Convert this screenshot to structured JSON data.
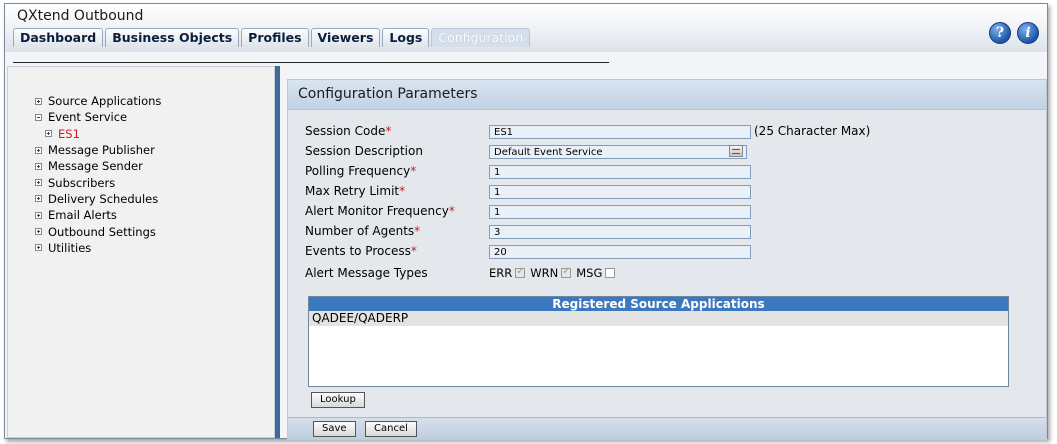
{
  "app": {
    "title": "QXtend Outbound"
  },
  "tabs": [
    {
      "label": "Dashboard"
    },
    {
      "label": "Business Objects"
    },
    {
      "label": "Profiles"
    },
    {
      "label": "Viewers"
    },
    {
      "label": "Logs"
    },
    {
      "label": "Configuration",
      "active": true
    }
  ],
  "header_icons": {
    "help": "help-icon",
    "info": "info-icon",
    "help_glyph": "?",
    "info_glyph": "i"
  },
  "tree": {
    "items": [
      {
        "label": "Source Applications",
        "expander": "plus"
      },
      {
        "label": "Event Service",
        "expander": "minus"
      },
      {
        "label": "ES1",
        "expander": "plus",
        "child": true,
        "selected": true
      },
      {
        "label": "Message Publisher",
        "expander": "plus"
      },
      {
        "label": "Message Sender",
        "expander": "plus"
      },
      {
        "label": "Subscribers",
        "expander": "plus"
      },
      {
        "label": "Delivery Schedules",
        "expander": "plus"
      },
      {
        "label": "Email Alerts",
        "expander": "plus"
      },
      {
        "label": "Outbound Settings",
        "expander": "plus"
      },
      {
        "label": "Utilities",
        "expander": "plus"
      }
    ]
  },
  "config": {
    "title": "Configuration Parameters",
    "fields": {
      "session_code": {
        "label": "Session Code",
        "value": "ES1"
      },
      "session_description": {
        "label": "Session Description",
        "value": "Default Event Service"
      },
      "polling_frequency": {
        "label": "Polling Frequency",
        "value": "1"
      },
      "max_retry_limit": {
        "label": "Max Retry Limit",
        "value": "1"
      },
      "alert_monitor_frequency": {
        "label": "Alert Monitor Frequency",
        "value": "1"
      },
      "number_of_agents": {
        "label": "Number of Agents",
        "value": "3"
      },
      "events_to_process": {
        "label": "Events to Process",
        "value": "20"
      },
      "alert_message_types": {
        "label": "Alert Message Types"
      }
    },
    "required_marker": "*",
    "max_note": "(25 Character Max)",
    "message_types": [
      {
        "label": "ERR",
        "checked": true
      },
      {
        "label": "WRN",
        "checked": true
      },
      {
        "label": "MSG",
        "checked": false
      }
    ],
    "registered": {
      "title": "Registered Source Applications",
      "rows": [
        "QADEE/QADERP"
      ]
    },
    "buttons": {
      "lookup": "Lookup",
      "save": "Save",
      "cancel": "Cancel"
    }
  }
}
